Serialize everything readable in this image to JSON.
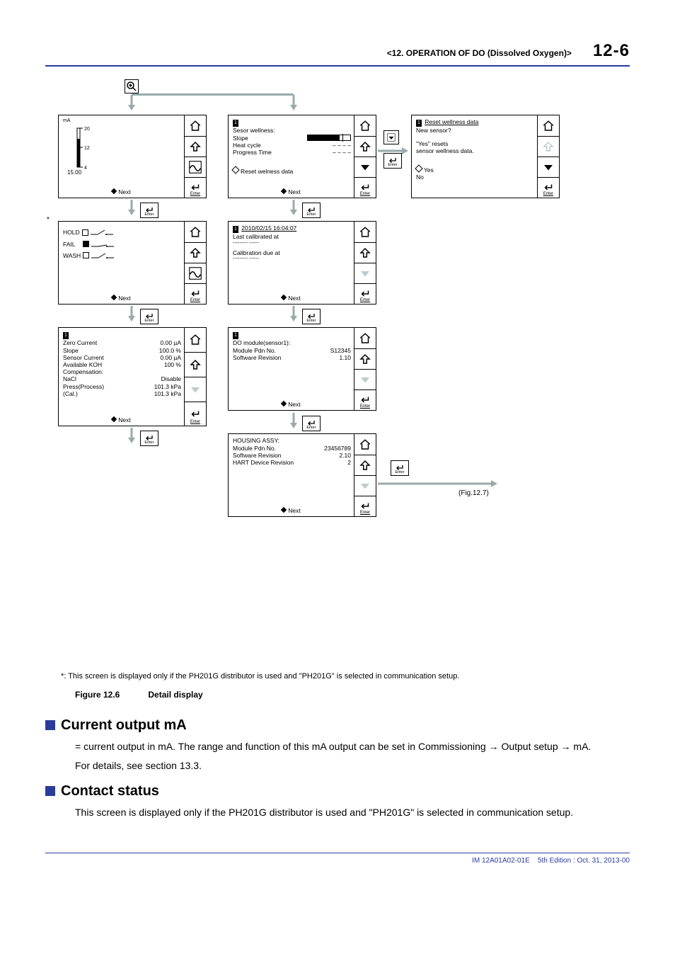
{
  "header": {
    "chapter": "<12.  OPERATION OF DO (Dissolved Oxygen)>",
    "page": "12-6"
  },
  "ui": {
    "next": "Next",
    "enter": "Enter"
  },
  "panel_ma": {
    "unit": "mA",
    "top_tick": "20",
    "mid_tick": "12",
    "bot_tick": "4",
    "value": "15.00"
  },
  "panel_contacts": {
    "star": "*",
    "hold": "HOLD",
    "fail": "FAIL",
    "wash": "WASH"
  },
  "panel_params": {
    "tag": "1",
    "r1l": "Zero Current",
    "r1v": "0.00 µA",
    "r2l": "Slope",
    "r2v": "100.0 %",
    "r3l": "Sensor Current",
    "r3v": "0.00 µA",
    "r4l": "Available KOH",
    "r4v": "100 %",
    "r5l": "Compensation:",
    "r5v": "",
    "r6l": " NaCl",
    "r6v": "Disable",
    "r7l": " Press(Process)",
    "r7v": "101.3 kPa",
    "r8l": "(Cal.)",
    "r8v": "101.3 kPa"
  },
  "panel_wellness": {
    "tag": "1",
    "title": "Sesor wellness:",
    "slope": "Slope",
    "heat": "Heat cycle",
    "heat_v": "– – – –",
    "prog": "Progress Time",
    "prog_v": "– – – –",
    "reset": "Reset welness data"
  },
  "panel_cal": {
    "tag": "1",
    "ts": "2010/02/15 16:04:07",
    "last": "Last calibrated at",
    "last_v": "--------- ------",
    "due": "Calibration due at",
    "due_v": "--------- ------"
  },
  "panel_module": {
    "tag": "1",
    "title": "DO module(sensor1):",
    "pdn_l": "Module Pdn No.",
    "pdn_v": "S12345",
    "sw_l": "Software Revision",
    "sw_v": "1.10"
  },
  "panel_housing": {
    "title": "HOUSING ASSY:",
    "pdn_l": "Module Pdn No.",
    "pdn_v": "23456789",
    "sw_l": "Software Revision",
    "sw_v": "2.10",
    "hart_l": "HART Device Revision",
    "hart_v": "2"
  },
  "panel_reset": {
    "tag": "1",
    "title_u": "Reset wellness data",
    "new": "New sensor?",
    "note1": "\"Yes\"  resets",
    "note2": "sensor wellness data.",
    "yes": "Yes",
    "no": "No"
  },
  "fig_ref": "(Fig.12.7)",
  "footnote": "*: This screen is displayed only if the PH201G distributor is used and \"PH201G\" is selected in communication setup.",
  "fig_caption_a": "Figure 12.6",
  "fig_caption_b": "Detail display",
  "sec1_title": "Current output mA",
  "sec1_p1": "= current output in mA. The range and function of this mA output can be set in Commissioning → Output setup → mA.",
  "sec1_p2": "For details, see section 13.3.",
  "sec2_title": "Contact status",
  "sec2_p1": "This screen is displayed only if the PH201G distributor is used and \"PH201G\" is selected in communication setup.",
  "footer": {
    "doc": "IM 12A01A02-01E",
    "edition": "5th Edition : Oct. 31, 2013-00"
  }
}
